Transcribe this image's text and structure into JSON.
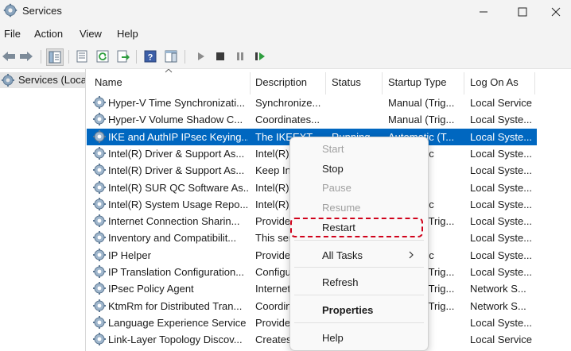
{
  "window": {
    "title": "Services"
  },
  "menu": [
    "File",
    "Action",
    "View",
    "Help"
  ],
  "tree": {
    "item": "Services (Local)"
  },
  "columns": [
    "Name",
    "Description",
    "Status",
    "Startup Type",
    "Log On As"
  ],
  "rows": [
    {
      "name": "Hyper-V Time Synchronizati...",
      "desc": "Synchronize...",
      "status": "",
      "startup": "Manual (Trig...",
      "logon": "Local Service"
    },
    {
      "name": "Hyper-V Volume Shadow C...",
      "desc": "Coordinates...",
      "status": "",
      "startup": "Manual (Trig...",
      "logon": "Local Syste..."
    },
    {
      "name": "IKE and AuthIP IPsec Keying...",
      "desc": "The IKEEXT ...",
      "status": "Running",
      "startup": "Automatic (T...",
      "logon": "Local Syste..."
    },
    {
      "name": "Intel(R) Driver & Support As...",
      "desc": "Intel(R) Driv...",
      "status": "",
      "startup": "Automatic",
      "logon": "Local Syste..."
    },
    {
      "name": "Intel(R) Driver & Support As...",
      "desc": "Keep Intel(R)...",
      "status": "",
      "startup": "",
      "logon": "Local Syste..."
    },
    {
      "name": "Intel(R) SUR QC Software As...",
      "desc": "Intel(R) SUR...",
      "status": "",
      "startup": "",
      "logon": "Local Syste..."
    },
    {
      "name": "Intel(R) System Usage Repo...",
      "desc": "Intel(R) Syst...",
      "status": "",
      "startup": "Automatic",
      "logon": "Local Syste..."
    },
    {
      "name": "Internet Connection Sharin...",
      "desc": "Provides net...",
      "status": "",
      "startup": "Manual (Trig...",
      "logon": "Local Syste..."
    },
    {
      "name": "Inventory and Compatibilit...",
      "desc": "This service ...",
      "status": "",
      "startup": "",
      "logon": "Local Syste..."
    },
    {
      "name": "IP Helper",
      "desc": "Provides tun...",
      "status": "",
      "startup": "Automatic",
      "logon": "Local Syste..."
    },
    {
      "name": "IP Translation Configuration...",
      "desc": "Configures ...",
      "status": "",
      "startup": "Manual (Trig...",
      "logon": "Local Syste..."
    },
    {
      "name": "IPsec Policy Agent",
      "desc": "Internet Pro...",
      "status": "",
      "startup": "Manual (Trig...",
      "logon": "Network S..."
    },
    {
      "name": "KtmRm for Distributed Tran...",
      "desc": "Coordinates...",
      "status": "",
      "startup": "Manual (Trig...",
      "logon": "Network S..."
    },
    {
      "name": "Language Experience Service",
      "desc": "Provides infr...",
      "status": "",
      "startup": "",
      "logon": "Local Syste..."
    },
    {
      "name": "Link-Layer Topology Discov...",
      "desc": "Creates a Ne...",
      "status": "",
      "startup": "",
      "logon": "Local Service"
    }
  ],
  "context_menu": {
    "start": "Start",
    "stop": "Stop",
    "pause": "Pause",
    "resume": "Resume",
    "restart": "Restart",
    "all_tasks": "All Tasks",
    "refresh": "Refresh",
    "properties": "Properties",
    "help": "Help"
  },
  "colors": {
    "selection": "#0067c0",
    "highlight": "#d0021b",
    "accent_green": "#2e9e3e"
  }
}
